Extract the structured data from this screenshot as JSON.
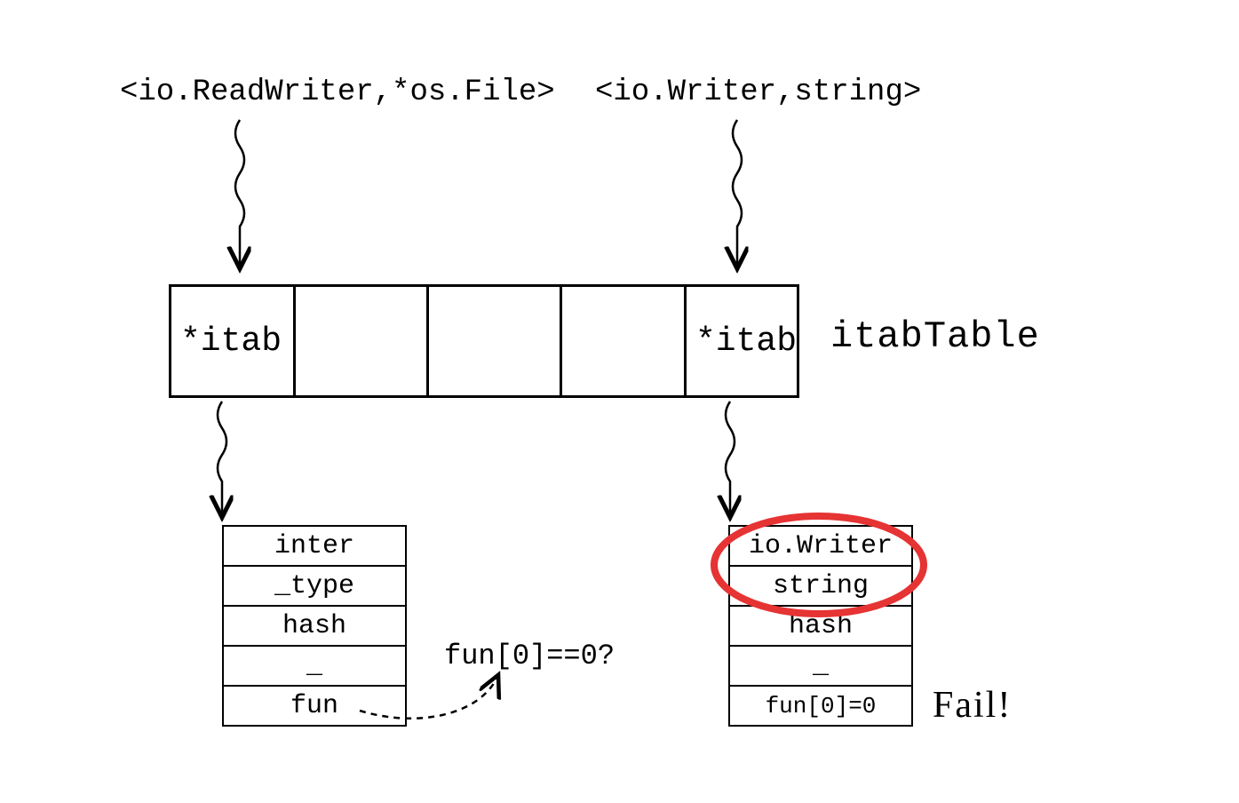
{
  "top_labels": {
    "left": "<io.ReadWriter,*os.File>",
    "right": "<io.Writer,string>"
  },
  "itab_table": {
    "cells": [
      "*itab",
      "",
      "",
      "",
      "*itab"
    ],
    "title": "itabTable"
  },
  "left_struct": {
    "rows": [
      "inter",
      "_type",
      "hash",
      "_",
      "fun"
    ]
  },
  "right_struct": {
    "rows": [
      "io.Writer",
      "string",
      "hash",
      "_",
      "fun[0]=0"
    ]
  },
  "annotations": {
    "fun_question": "fun[0]==0?",
    "fail": "Fail!"
  }
}
